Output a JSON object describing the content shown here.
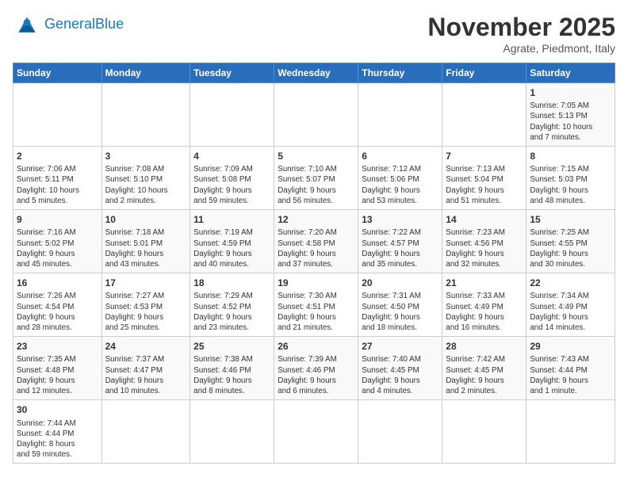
{
  "header": {
    "logo_general": "General",
    "logo_blue": "Blue",
    "month": "November 2025",
    "location": "Agrate, Piedmont, Italy"
  },
  "days_of_week": [
    "Sunday",
    "Monday",
    "Tuesday",
    "Wednesday",
    "Thursday",
    "Friday",
    "Saturday"
  ],
  "weeks": [
    [
      {
        "day": "",
        "info": ""
      },
      {
        "day": "",
        "info": ""
      },
      {
        "day": "",
        "info": ""
      },
      {
        "day": "",
        "info": ""
      },
      {
        "day": "",
        "info": ""
      },
      {
        "day": "",
        "info": ""
      },
      {
        "day": "1",
        "info": "Sunrise: 7:05 AM\nSunset: 5:13 PM\nDaylight: 10 hours\nand 7 minutes."
      }
    ],
    [
      {
        "day": "2",
        "info": "Sunrise: 7:06 AM\nSunset: 5:11 PM\nDaylight: 10 hours\nand 5 minutes."
      },
      {
        "day": "3",
        "info": "Sunrise: 7:08 AM\nSunset: 5:10 PM\nDaylight: 10 hours\nand 2 minutes."
      },
      {
        "day": "4",
        "info": "Sunrise: 7:09 AM\nSunset: 5:08 PM\nDaylight: 9 hours\nand 59 minutes."
      },
      {
        "day": "5",
        "info": "Sunrise: 7:10 AM\nSunset: 5:07 PM\nDaylight: 9 hours\nand 56 minutes."
      },
      {
        "day": "6",
        "info": "Sunrise: 7:12 AM\nSunset: 5:06 PM\nDaylight: 9 hours\nand 53 minutes."
      },
      {
        "day": "7",
        "info": "Sunrise: 7:13 AM\nSunset: 5:04 PM\nDaylight: 9 hours\nand 51 minutes."
      },
      {
        "day": "8",
        "info": "Sunrise: 7:15 AM\nSunset: 5:03 PM\nDaylight: 9 hours\nand 48 minutes."
      }
    ],
    [
      {
        "day": "9",
        "info": "Sunrise: 7:16 AM\nSunset: 5:02 PM\nDaylight: 9 hours\nand 45 minutes."
      },
      {
        "day": "10",
        "info": "Sunrise: 7:18 AM\nSunset: 5:01 PM\nDaylight: 9 hours\nand 43 minutes."
      },
      {
        "day": "11",
        "info": "Sunrise: 7:19 AM\nSunset: 4:59 PM\nDaylight: 9 hours\nand 40 minutes."
      },
      {
        "day": "12",
        "info": "Sunrise: 7:20 AM\nSunset: 4:58 PM\nDaylight: 9 hours\nand 37 minutes."
      },
      {
        "day": "13",
        "info": "Sunrise: 7:22 AM\nSunset: 4:57 PM\nDaylight: 9 hours\nand 35 minutes."
      },
      {
        "day": "14",
        "info": "Sunrise: 7:23 AM\nSunset: 4:56 PM\nDaylight: 9 hours\nand 32 minutes."
      },
      {
        "day": "15",
        "info": "Sunrise: 7:25 AM\nSunset: 4:55 PM\nDaylight: 9 hours\nand 30 minutes."
      }
    ],
    [
      {
        "day": "16",
        "info": "Sunrise: 7:26 AM\nSunset: 4:54 PM\nDaylight: 9 hours\nand 28 minutes."
      },
      {
        "day": "17",
        "info": "Sunrise: 7:27 AM\nSunset: 4:53 PM\nDaylight: 9 hours\nand 25 minutes."
      },
      {
        "day": "18",
        "info": "Sunrise: 7:29 AM\nSunset: 4:52 PM\nDaylight: 9 hours\nand 23 minutes."
      },
      {
        "day": "19",
        "info": "Sunrise: 7:30 AM\nSunset: 4:51 PM\nDaylight: 9 hours\nand 21 minutes."
      },
      {
        "day": "20",
        "info": "Sunrise: 7:31 AM\nSunset: 4:50 PM\nDaylight: 9 hours\nand 18 minutes."
      },
      {
        "day": "21",
        "info": "Sunrise: 7:33 AM\nSunset: 4:49 PM\nDaylight: 9 hours\nand 16 minutes."
      },
      {
        "day": "22",
        "info": "Sunrise: 7:34 AM\nSunset: 4:49 PM\nDaylight: 9 hours\nand 14 minutes."
      }
    ],
    [
      {
        "day": "23",
        "info": "Sunrise: 7:35 AM\nSunset: 4:48 PM\nDaylight: 9 hours\nand 12 minutes."
      },
      {
        "day": "24",
        "info": "Sunrise: 7:37 AM\nSunset: 4:47 PM\nDaylight: 9 hours\nand 10 minutes."
      },
      {
        "day": "25",
        "info": "Sunrise: 7:38 AM\nSunset: 4:46 PM\nDaylight: 9 hours\nand 8 minutes."
      },
      {
        "day": "26",
        "info": "Sunrise: 7:39 AM\nSunset: 4:46 PM\nDaylight: 9 hours\nand 6 minutes."
      },
      {
        "day": "27",
        "info": "Sunrise: 7:40 AM\nSunset: 4:45 PM\nDaylight: 9 hours\nand 4 minutes."
      },
      {
        "day": "28",
        "info": "Sunrise: 7:42 AM\nSunset: 4:45 PM\nDaylight: 9 hours\nand 2 minutes."
      },
      {
        "day": "29",
        "info": "Sunrise: 7:43 AM\nSunset: 4:44 PM\nDaylight: 9 hours\nand 1 minute."
      }
    ],
    [
      {
        "day": "30",
        "info": "Sunrise: 7:44 AM\nSunset: 4:44 PM\nDaylight: 8 hours\nand 59 minutes."
      },
      {
        "day": "",
        "info": ""
      },
      {
        "day": "",
        "info": ""
      },
      {
        "day": "",
        "info": ""
      },
      {
        "day": "",
        "info": ""
      },
      {
        "day": "",
        "info": ""
      },
      {
        "day": "",
        "info": ""
      }
    ]
  ]
}
